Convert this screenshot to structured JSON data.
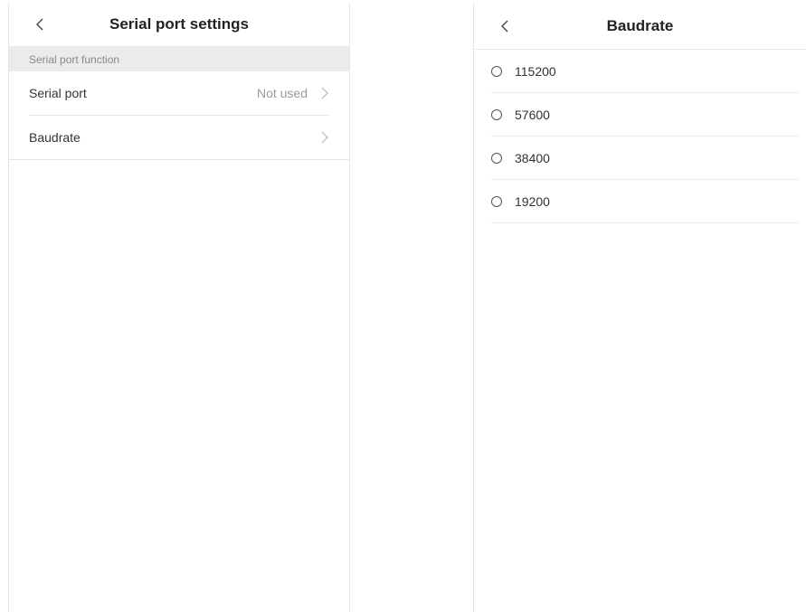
{
  "left": {
    "title": "Serial port settings",
    "section_label": "Serial port function",
    "rows": [
      {
        "label": "Serial port",
        "value": "Not used"
      },
      {
        "label": "Baudrate",
        "value": ""
      }
    ]
  },
  "right": {
    "title": "Baudrate",
    "options": [
      "115200",
      "57600",
      "38400",
      "19200"
    ],
    "selected": null
  },
  "icons": {
    "back": "chevron-left-icon",
    "next": "chevron-right-icon",
    "radio": "radio-unchecked-icon"
  },
  "colors": {
    "section_bg": "#ebebeb",
    "divider": "#e6e6e6",
    "secondary_text": "#9a9a9a"
  }
}
